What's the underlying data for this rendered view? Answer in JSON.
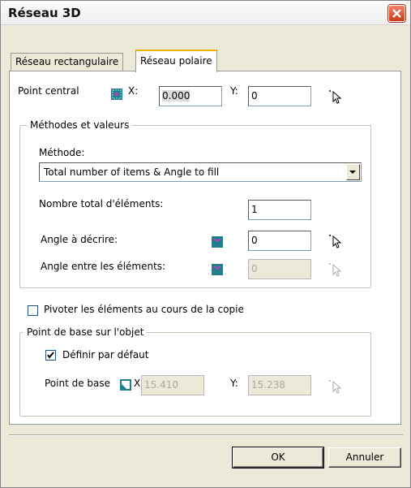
{
  "window": {
    "title": "Réseau 3D"
  },
  "tabs": [
    {
      "label": "Réseau rectangulaire",
      "active": false
    },
    {
      "label": "Réseau polaire",
      "active": true
    }
  ],
  "center_point": {
    "label": "Point central",
    "x_label": "X:",
    "x_value": "0.000",
    "y_label": "Y:",
    "y_value": "0"
  },
  "methods_group": {
    "title": "Méthodes et valeurs",
    "method_label": "Méthode:",
    "method_value": "Total number of items & Angle to fill",
    "total_items_label": "Nombre total d'éléments:",
    "total_items_value": "1",
    "angle_fill_label": "Angle à décrire:",
    "angle_fill_value": "0",
    "angle_between_label": "Angle entre les éléments:",
    "angle_between_value": "0"
  },
  "rotate_items": {
    "label": "Pivoter les éléments au cours de la copie",
    "checked": false
  },
  "base_point_group": {
    "title": "Point de base sur l'objet",
    "default_label": "Définir par défaut",
    "default_checked": true,
    "base_point_label": "Point de base",
    "x_label": "X:",
    "x_value": "15.410",
    "y_label": "Y:",
    "y_value": "15.238"
  },
  "buttons": {
    "ok": "OK",
    "cancel": "Annuler"
  },
  "colors": {
    "close_button": "#cb3a1d",
    "icon_fill": "#1f7f8c",
    "icon_mark": "#c040c0",
    "disabled_text": "#a8a8a8"
  }
}
